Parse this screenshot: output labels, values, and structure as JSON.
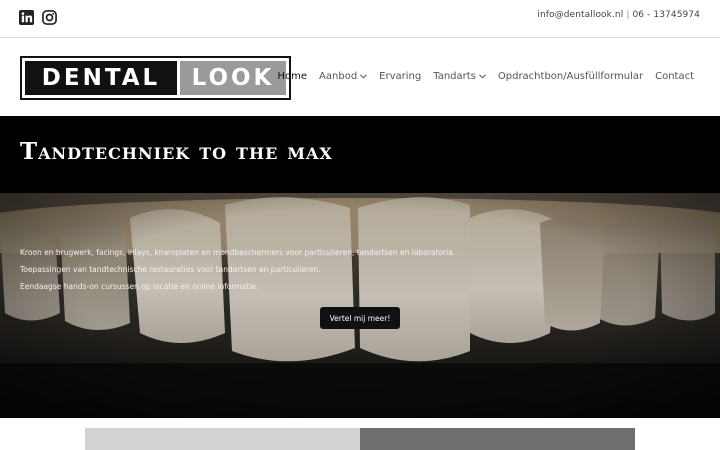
{
  "topbar": {
    "social": [
      "linkedin-icon",
      "instagram-icon"
    ],
    "email": "info@dentallook.nl",
    "separator": "|",
    "phone": "06 - 13745974"
  },
  "logo": {
    "left": "DENTAL",
    "right": "LOOK"
  },
  "nav": {
    "items": [
      {
        "label": "Home",
        "has_dropdown": false,
        "active": true
      },
      {
        "label": "Aanbod",
        "has_dropdown": true
      },
      {
        "label": "Ervaring",
        "has_dropdown": false
      },
      {
        "label": "Tandarts",
        "has_dropdown": true
      },
      {
        "label": "Opdrachtbon/Ausfüllformular",
        "has_dropdown": false
      },
      {
        "label": "Contact",
        "has_dropdown": false
      }
    ]
  },
  "hero": {
    "title": "Tandtechniek to the max",
    "lines": [
      "Kroon en brugwerk, facings, inlays, knarsplaten en mondbeschermers voor particulieren, tandartsen en laboratoria.",
      "Toepassingen van tandtechnische restauraties voor tandartsen en particulieren.",
      "Eendaagse hands-on cursussen op locatie en online informatie."
    ],
    "button": "Vertel mij meer!"
  },
  "colors": {
    "black": "#000000",
    "logo_gray": "#9a9a9a",
    "panel_light": "#d2d2d2",
    "panel_dark": "#6e6e6e"
  }
}
